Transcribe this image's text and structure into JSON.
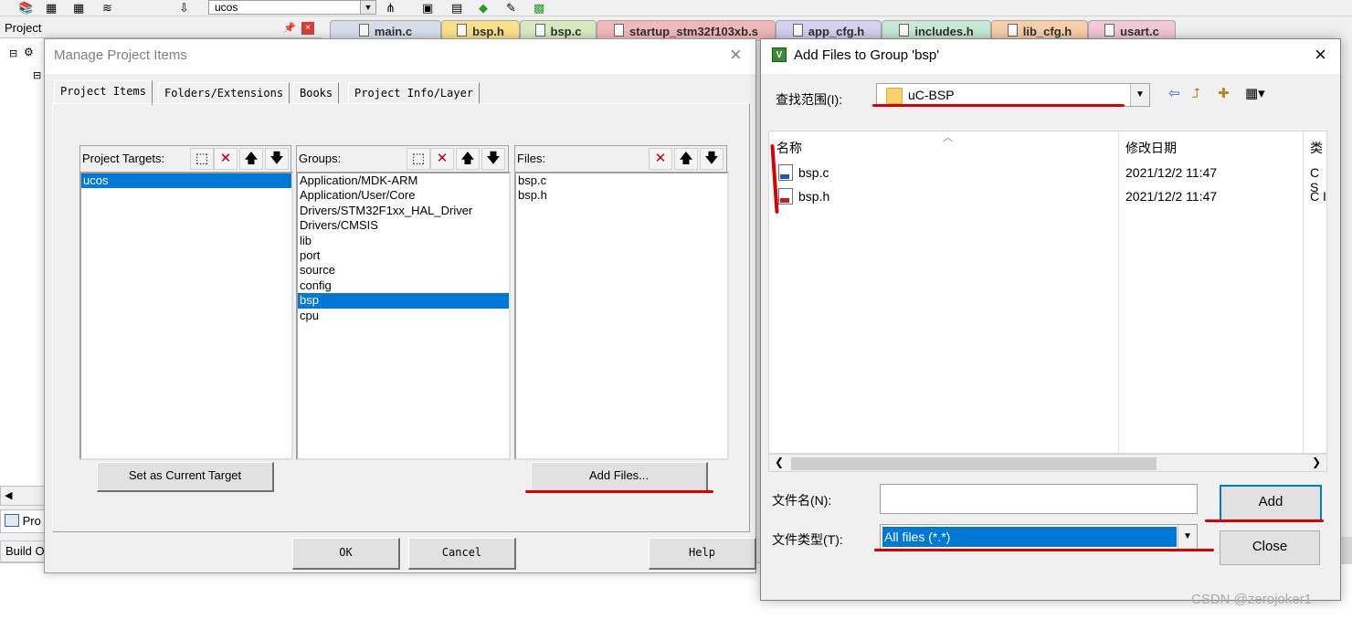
{
  "ide": {
    "target_name": "ucos",
    "project_panel_title": "Project",
    "project_tab_label": "Pro",
    "build_panel_label": "Build O",
    "editor_tabs": [
      {
        "label": "main.c",
        "color": "#d8dce8"
      },
      {
        "label": "bsp.h",
        "color": "#f8e08a"
      },
      {
        "label": "bsp.c",
        "color": "#d8e8c0"
      },
      {
        "label": "startup_stm32f103xb.s",
        "color": "#f0b8b8"
      },
      {
        "label": "app_cfg.h",
        "color": "#d8d0f0"
      },
      {
        "label": "includes.h",
        "color": "#c8e8d8"
      },
      {
        "label": "lib_cfg.h",
        "color": "#f8d0a8"
      },
      {
        "label": "usart.c",
        "color": "#f0c8d8"
      }
    ]
  },
  "manage_dialog": {
    "title": "Manage Project Items",
    "tabs": [
      "Project Items",
      "Folders/Extensions",
      "Books",
      "Project Info/Layer"
    ],
    "targets_label": "Project Targets:",
    "targets": [
      "ucos"
    ],
    "groups_label": "Groups:",
    "groups": [
      "Application/MDK-ARM",
      "Application/User/Core",
      "Drivers/STM32F1xx_HAL_Driver",
      "Drivers/CMSIS",
      "lib",
      "port",
      "source",
      "config",
      "bsp",
      "cpu"
    ],
    "selected_group": "bsp",
    "files_label": "Files:",
    "files": [
      "bsp.c",
      "bsp.h"
    ],
    "set_target_button": "Set as Current Target",
    "add_files_button": "Add Files...",
    "ok_button": "OK",
    "cancel_button": "Cancel",
    "help_button": "Help"
  },
  "add_dialog": {
    "title": "Add Files to Group 'bsp'",
    "app_icon_letter": "V",
    "look_in_label": "查找范围(I):",
    "look_in_value": "uC-BSP",
    "col_name": "名称",
    "col_date": "修改日期",
    "col_type": "类",
    "files": [
      {
        "name": "bsp.c",
        "date": "2021/12/2 11:47",
        "type": "C S",
        "icon": "c"
      },
      {
        "name": "bsp.h",
        "date": "2021/12/2 11:47",
        "type": "C I",
        "icon": "h"
      }
    ],
    "filename_label": "文件名(N):",
    "filename_value": "",
    "filetype_label": "文件类型(T):",
    "filetype_value": "All files (*.*)",
    "add_button": "Add",
    "close_button": "Close"
  },
  "watermark": "CSDN @zerojoker1",
  "colors": {
    "accent": "#0078d7",
    "annotation_red": "#d80000"
  }
}
